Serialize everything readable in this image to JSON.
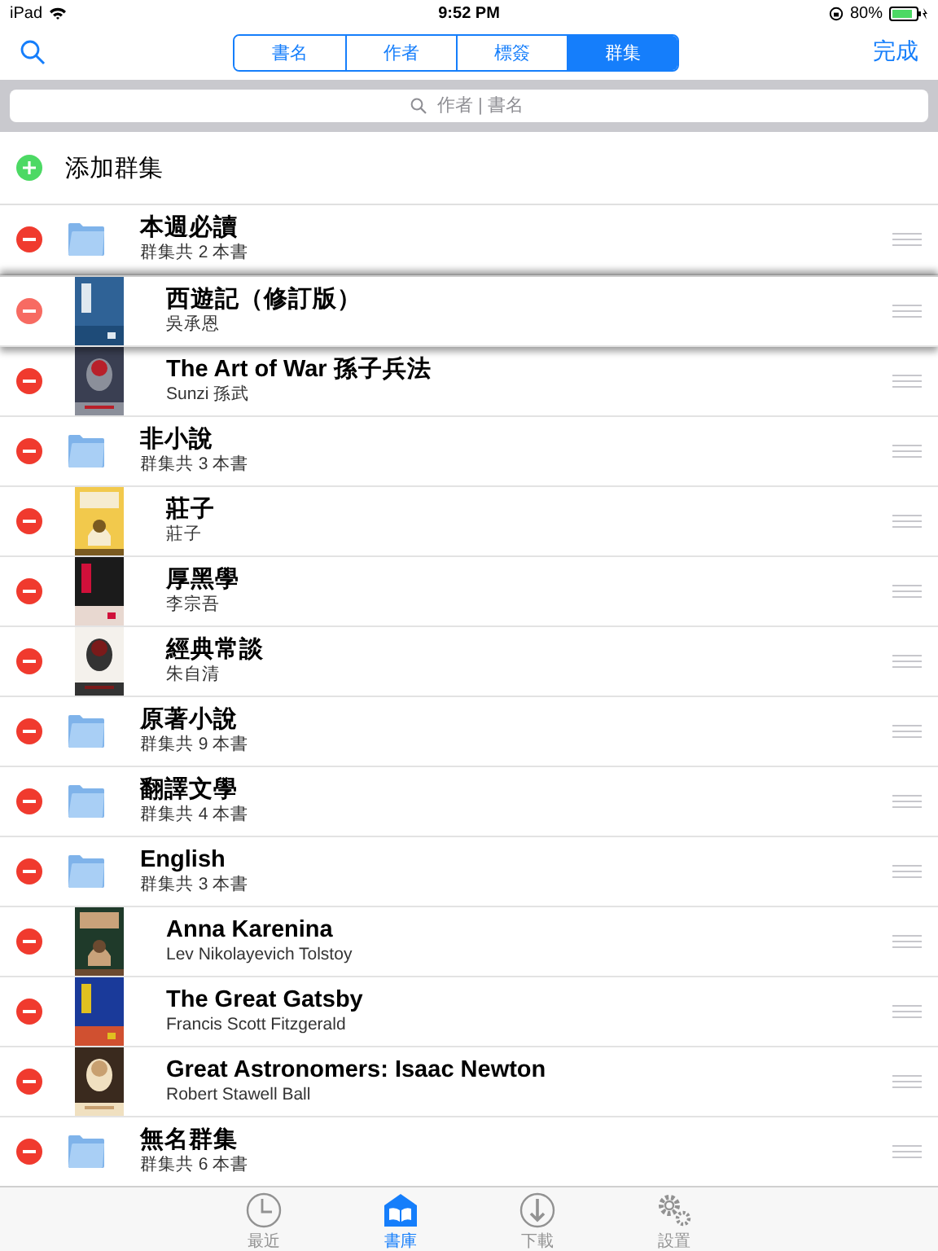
{
  "status_bar": {
    "device": "iPad",
    "time": "9:52 PM",
    "battery": "80%"
  },
  "nav": {
    "segments": [
      {
        "label": "書名",
        "selected": false
      },
      {
        "label": "作者",
        "selected": false
      },
      {
        "label": "標簽",
        "selected": false
      },
      {
        "label": "群集",
        "selected": true
      }
    ],
    "done": "完成"
  },
  "search": {
    "placeholder": "作者 | 書名"
  },
  "add_group": "添加群集",
  "rows": [
    {
      "kind": "folder",
      "title": "本週必讀",
      "subtitle": "群集共 2 本書",
      "dragging": false
    },
    {
      "kind": "book",
      "title": "西遊記（修訂版）",
      "subtitle": "吳承恩",
      "dragging": true
    },
    {
      "kind": "book",
      "title": "The Art of War 孫子兵法",
      "subtitle": "Sunzi 孫武",
      "dragging": false
    },
    {
      "kind": "folder",
      "title": "非小說",
      "subtitle": "群集共 3 本書",
      "dragging": false
    },
    {
      "kind": "book",
      "title": "莊子",
      "subtitle": "莊子",
      "dragging": false
    },
    {
      "kind": "book",
      "title": "厚黑學",
      "subtitle": "李宗吾",
      "dragging": false
    },
    {
      "kind": "book",
      "title": "經典常談",
      "subtitle": "朱自清",
      "dragging": false
    },
    {
      "kind": "folder",
      "title": "原著小說",
      "subtitle": "群集共 9 本書",
      "dragging": false
    },
    {
      "kind": "folder",
      "title": "翻譯文學",
      "subtitle": "群集共 4 本書",
      "dragging": false
    },
    {
      "kind": "folder",
      "title": "English",
      "subtitle": "群集共 3 本書",
      "dragging": false
    },
    {
      "kind": "book",
      "title": "Anna Karenina",
      "subtitle": "Lev Nikolayevich Tolstoy",
      "dragging": false
    },
    {
      "kind": "book",
      "title": "The Great Gatsby",
      "subtitle": "Francis Scott Fitzgerald",
      "dragging": false
    },
    {
      "kind": "book",
      "title": "Great Astronomers: Isaac Newton",
      "subtitle": "Robert Stawell Ball",
      "dragging": false
    },
    {
      "kind": "folder",
      "title": "無名群集",
      "subtitle": "群集共 6 本書",
      "dragging": false
    }
  ],
  "tab_bar": [
    {
      "label": "最近",
      "selected": false
    },
    {
      "label": "書庫",
      "selected": true
    },
    {
      "label": "下載",
      "selected": false
    },
    {
      "label": "設置",
      "selected": false
    }
  ]
}
